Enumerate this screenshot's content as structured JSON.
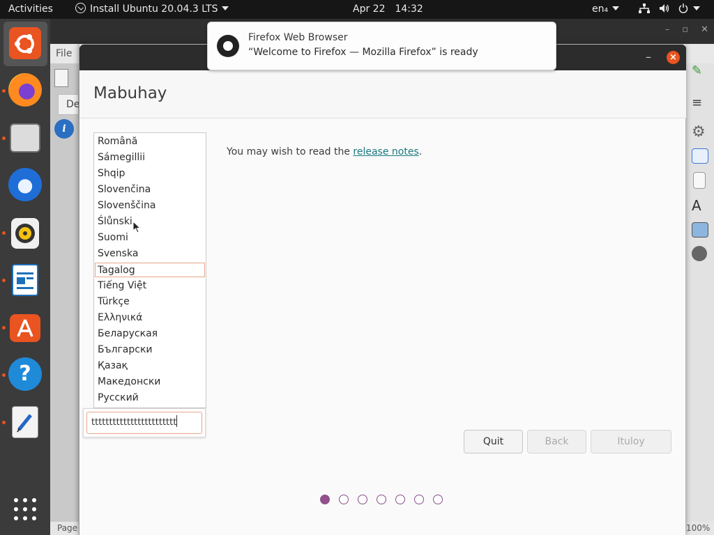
{
  "topbar": {
    "activities": "Activities",
    "app_menu": "Install Ubuntu 20.04.3 LTS",
    "date": "Apr 22",
    "time": "14:32",
    "lang": "en₄",
    "icons": [
      "network-icon",
      "volume-icon",
      "power-icon"
    ]
  },
  "dock": {
    "apps": [
      "ubuntu-installer-icon",
      "firefox-icon",
      "files-icon",
      "thunderbird-icon",
      "rhythmbox-icon",
      "libreoffice-writer-icon",
      "software-center-icon",
      "help-icon",
      "text-editor-icon",
      "show-applications-icon"
    ]
  },
  "background_window": {
    "menu_file": "File",
    "status_page": "Page",
    "zoom": "100%"
  },
  "notification": {
    "app": "Firefox Web Browser",
    "message": "“Welcome to Firefox — Mozilla Firefox” is ready"
  },
  "installer": {
    "heading": "Mabuhay",
    "languages": [
      "Română",
      "Sámegillii",
      "Shqip",
      "Slovenčina",
      "Slovenščina",
      "Ślůnski",
      "Suomi",
      "Svenska",
      "Tagalog",
      "Tiếng Việt",
      "Türkçe",
      "Ελληνικά",
      "Беларуская",
      "Български",
      "Қазақ",
      "Македонски",
      "Русский"
    ],
    "selected_language": "Tagalog",
    "search_value": "tttttttttttttttttttttttt",
    "notes_prefix": "You may wish to read the ",
    "notes_link": "release notes",
    "notes_suffix": ".",
    "buttons": {
      "quit": "Quit",
      "back": "Back",
      "continue": "Ituloy"
    },
    "steps_total": 7,
    "step_current": 1
  },
  "colors": {
    "accent": "#e95420",
    "link": "#19797f",
    "step": "#92508c"
  }
}
